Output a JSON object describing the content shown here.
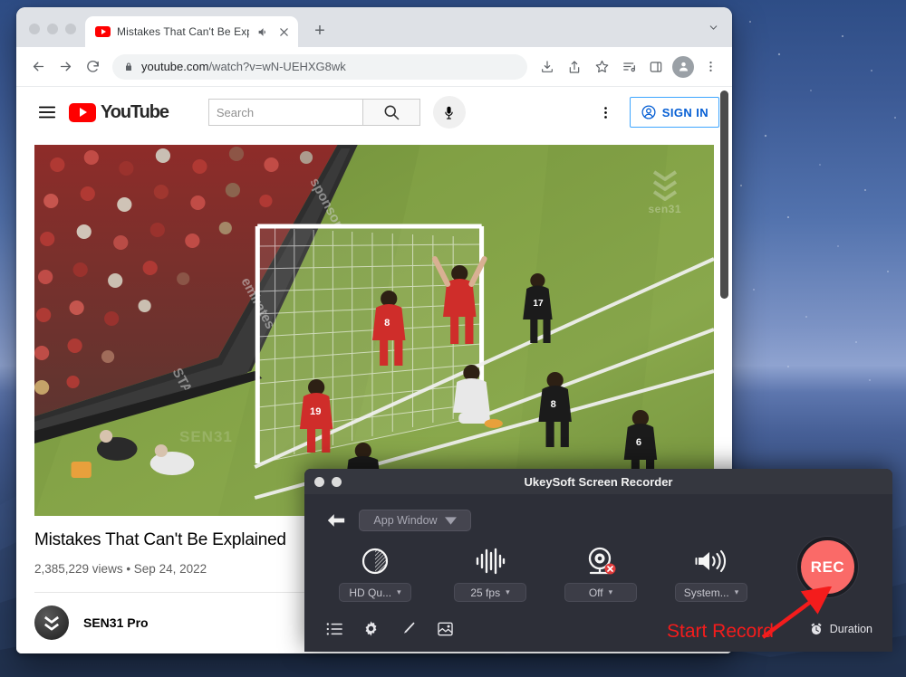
{
  "browser": {
    "tab": {
      "title": "Mistakes That Can't Be Exp",
      "favicon_icon": "youtube-icon",
      "mute_icon": "speaker-icon",
      "close_icon": "close-icon"
    },
    "new_tab_label": "+",
    "tab_list_icon": "chevron-down-icon",
    "toolbar": {
      "back_icon": "arrow-left-icon",
      "forward_icon": "arrow-right-icon",
      "reload_icon": "reload-icon",
      "lock_icon": "lock-icon",
      "url_domain": "youtube.com",
      "url_path": "/watch?v=wN-UEHXG8wk",
      "install_icon": "download-icon",
      "share_icon": "share-icon",
      "bookmark_icon": "star-icon",
      "reading_list_icon": "reading-list-icon",
      "side_panel_icon": "side-panel-icon",
      "profile_icon": "person-icon",
      "menu_icon": "three-dots-vertical-icon"
    }
  },
  "youtube": {
    "menu_icon": "hamburger-icon",
    "logo_text": "YouTube",
    "logo_icon": "youtube-play-icon",
    "search": {
      "placeholder": "Search",
      "icon": "search-icon"
    },
    "mic_icon": "microphone-icon",
    "settings_icon": "three-dots-vertical-icon",
    "sign_in": {
      "label": "SIGN IN",
      "icon": "account-circle-icon"
    },
    "video": {
      "watermark": "sen31",
      "watermark_bottom": "SEN31"
    },
    "title": "Mistakes That Can't Be Explained",
    "stats": "2,385,229 views • Sep 24, 2022",
    "channel": {
      "name": "SEN31 Pro",
      "avatar_icon": "channel-avatar-icon"
    }
  },
  "recorder": {
    "window_title": "UkeySoft Screen Recorder",
    "back_icon": "arrow-left-icon",
    "source_selector": {
      "label": "App Window",
      "chevron": "▾"
    },
    "options": [
      {
        "name": "quality",
        "icon": "contrast-circle-icon",
        "value": "HD Qu...",
        "chevron": "▾"
      },
      {
        "name": "framerate",
        "icon": "waveform-icon",
        "value": "25 fps",
        "chevron": "▾"
      },
      {
        "name": "webcam",
        "icon": "webcam-off-icon",
        "value": "Off",
        "chevron": "▾"
      },
      {
        "name": "audio",
        "icon": "speaker-icon",
        "value": "System...",
        "chevron": "▾"
      }
    ],
    "record_button": {
      "label": "REC",
      "color": "#fa6a68"
    },
    "tools": [
      {
        "name": "recordings-list",
        "icon": "list-icon"
      },
      {
        "name": "settings",
        "icon": "gear-icon"
      },
      {
        "name": "annotate",
        "icon": "pen-icon"
      },
      {
        "name": "screenshot",
        "icon": "image-icon"
      }
    ],
    "duration": {
      "label": "Duration",
      "icon": "alarm-clock-icon"
    }
  },
  "annotation": {
    "text": "Start Record",
    "color": "#f41c1c",
    "arrow_icon": "arrow-up-right-icon"
  }
}
